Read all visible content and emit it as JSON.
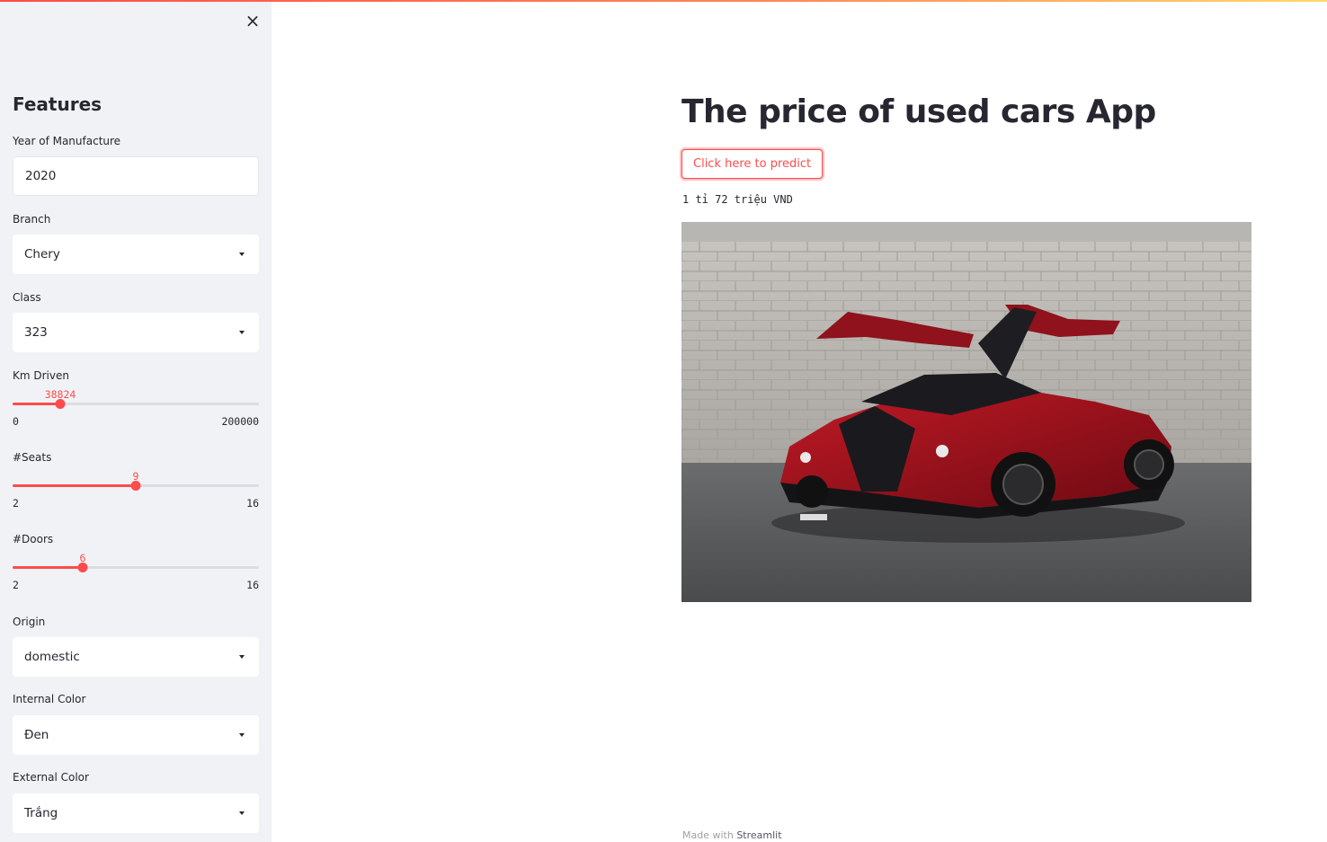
{
  "sidebar": {
    "close_icon": "×",
    "title": "Features",
    "year": {
      "label": "Year of Manufacture",
      "value": "2020"
    },
    "branch": {
      "label": "Branch",
      "value": "Chery"
    },
    "class": {
      "label": "Class",
      "value": "323"
    },
    "km": {
      "label": "Km Driven",
      "value": "38824",
      "min": "0",
      "max": "200000",
      "fraction": 0.194
    },
    "seats": {
      "label": "#Seats",
      "value": "9",
      "min": "2",
      "max": "16",
      "fraction": 0.5
    },
    "doors": {
      "label": "#Doors",
      "value": "6",
      "min": "2",
      "max": "16",
      "fraction": 0.2857
    },
    "origin": {
      "label": "Origin",
      "value": "domestic"
    },
    "internal_color": {
      "label": "Internal Color",
      "value": "Đen"
    },
    "external_color": {
      "label": "External Color",
      "value": "Trắng"
    }
  },
  "main": {
    "title": "The price of used cars App",
    "predict_button": "Click here to predict",
    "result": "1 tỉ 72 triệu VND"
  },
  "footer": {
    "prefix": "Made with ",
    "brand": "Streamlit"
  },
  "colors": {
    "accent": "#ff4b4b",
    "sidebar_bg": "#f0f2f6",
    "text": "#262730"
  },
  "icons": {
    "close": "close-icon",
    "dropdown": "chevron-down-icon"
  }
}
